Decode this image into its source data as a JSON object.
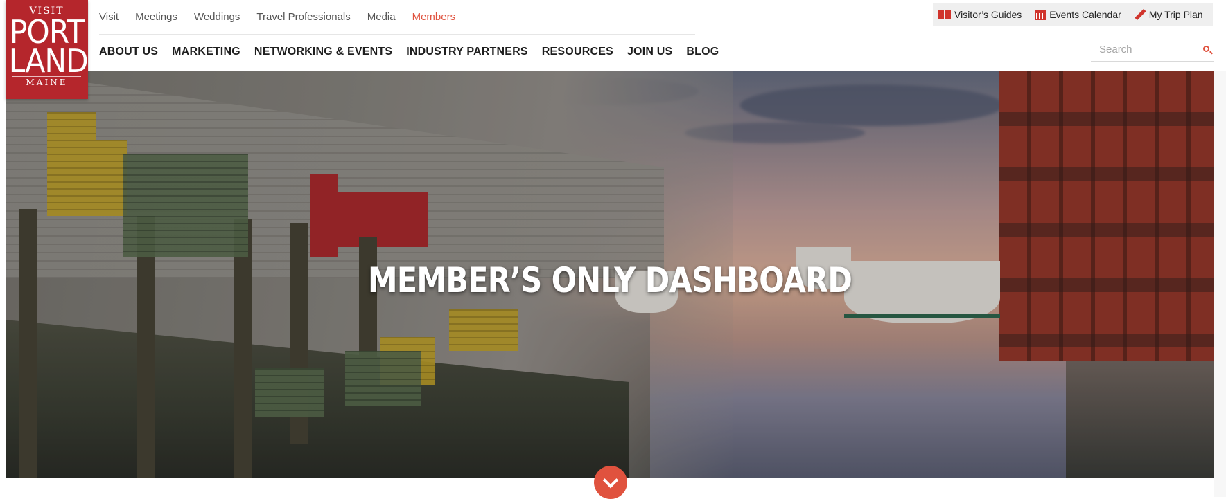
{
  "logo": {
    "visit": "VISIT",
    "line1": "PORT",
    "line2": "LAND",
    "state": "MAINE"
  },
  "top_nav": [
    {
      "label": "Visit",
      "active": false
    },
    {
      "label": "Meetings",
      "active": false
    },
    {
      "label": "Weddings",
      "active": false
    },
    {
      "label": "Travel Professionals",
      "active": false
    },
    {
      "label": "Media",
      "active": false
    },
    {
      "label": "Members",
      "active": true
    }
  ],
  "main_nav": [
    {
      "label": "ABOUT US"
    },
    {
      "label": "MARKETING"
    },
    {
      "label": "NETWORKING & EVENTS"
    },
    {
      "label": "INDUSTRY PARTNERS"
    },
    {
      "label": "RESOURCES"
    },
    {
      "label": "JOIN US"
    },
    {
      "label": "BLOG"
    }
  ],
  "utility": [
    {
      "label": "Visitor’s Guides",
      "icon": "book-icon"
    },
    {
      "label": "Events Calendar",
      "icon": "calendar-icon"
    },
    {
      "label": "My Trip Plan",
      "icon": "pencil-icon"
    }
  ],
  "search": {
    "placeholder": "Search"
  },
  "hero": {
    "title": "MEMBER’S ONLY DASHBOARD"
  },
  "colors": {
    "brand_red": "#b5262c",
    "accent": "#e0523e"
  }
}
